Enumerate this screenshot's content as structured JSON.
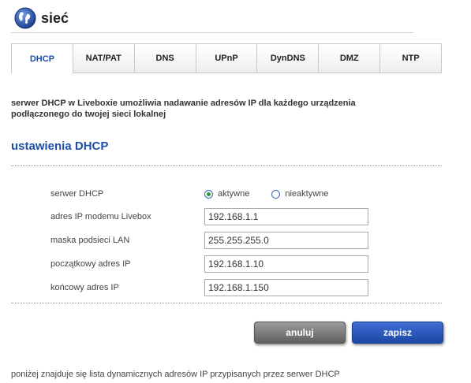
{
  "header": {
    "title": "sieć",
    "icon": "globe-icon"
  },
  "tabs": [
    {
      "label": "DHCP",
      "active": true
    },
    {
      "label": "NAT/PAT",
      "active": false
    },
    {
      "label": "DNS",
      "active": false
    },
    {
      "label": "UPnP",
      "active": false
    },
    {
      "label": "DynDNS",
      "active": false
    },
    {
      "label": "DMZ",
      "active": false
    },
    {
      "label": "NTP",
      "active": false
    }
  ],
  "intro": {
    "line1": "serwer DHCP w Liveboxie umożliwia nadawanie adresów IP dla każdego urządzenia",
    "line2": "podłączonego do twojej sieci lokalnej"
  },
  "section_title": "ustawienia DHCP",
  "form": {
    "dhcp_server": {
      "label": "serwer DHCP",
      "option_active": "aktywne",
      "option_inactive": "nieaktywne",
      "selected": "aktywne"
    },
    "modem_ip": {
      "label": "adres IP modemu Livebox",
      "value": "192.168.1.1"
    },
    "subnet_mask": {
      "label": "maska podsieci LAN",
      "value": "255.255.255.0"
    },
    "start_ip": {
      "label": "początkowy adres IP",
      "value": "192.168.1.10"
    },
    "end_ip": {
      "label": "końcowy adres IP",
      "value": "192.168.1.150"
    }
  },
  "buttons": {
    "cancel": "anuluj",
    "save": "zapisz"
  },
  "footer_text": "poniżej znajduje się lista dynamicznych adresów IP przypisanych przez serwer DHCP",
  "colors": {
    "accent": "#1f4fa8",
    "save_button": "#2a55b8",
    "cancel_button": "#7a7a7a",
    "radio_selected": "#2a9a3a"
  }
}
